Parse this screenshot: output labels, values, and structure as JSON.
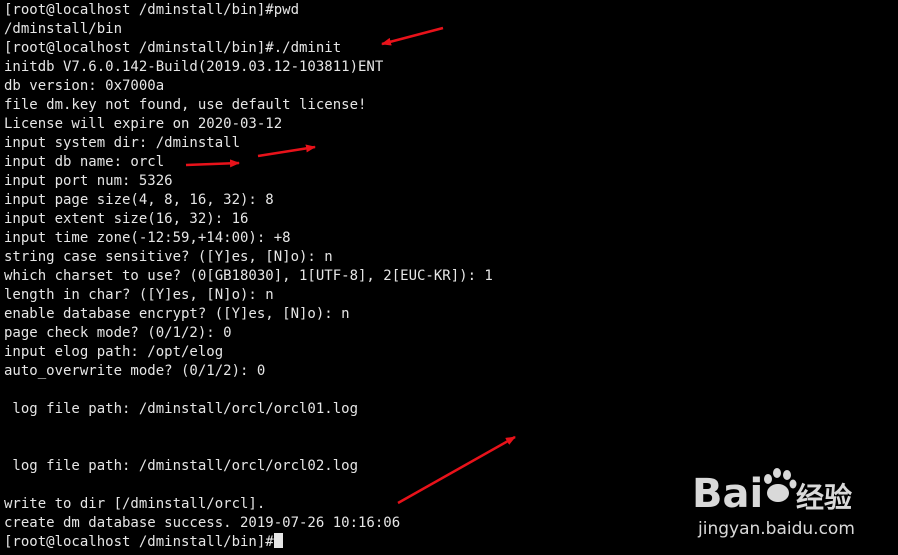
{
  "terminal": {
    "lines": [
      "[root@localhost /dminstall/bin]#pwd",
      "/dminstall/bin",
      "[root@localhost /dminstall/bin]#./dminit",
      "initdb V7.6.0.142-Build(2019.03.12-103811)ENT",
      "db version: 0x7000a",
      "file dm.key not found, use default license!",
      "License will expire on 2020-03-12",
      "input system dir: /dminstall",
      "input db name: orcl",
      "input port num: 5326",
      "input page size(4, 8, 16, 32): 8",
      "input extent size(16, 32): 16",
      "input time zone(-12:59,+14:00): +8",
      "string case sensitive? ([Y]es, [N]o): n",
      "which charset to use? (0[GB18030], 1[UTF-8], 2[EUC-KR]): 1",
      "length in char? ([Y]es, [N]o): n",
      "enable database encrypt? ([Y]es, [N]o): n",
      "page check mode? (0/1/2): 0",
      "input elog path: /opt/elog",
      "auto_overwrite mode? (0/1/2): 0",
      "",
      " log file path: /dminstall/orcl/orcl01.log",
      "",
      "",
      " log file path: /dminstall/orcl/orcl02.log",
      "",
      "write to dir [/dminstall/orcl].",
      "create dm database success. 2019-07-26 10:16:06",
      "[root@localhost /dminstall/bin]#"
    ],
    "text_color": "#e6e6e6",
    "background": "#000000",
    "cursor_color": "#e6e6e6"
  },
  "annotations": {
    "arrow_color": "#e8121a"
  },
  "watermark": {
    "logo_text": "Bai",
    "logo_suffix": "经验",
    "url": "jingyan.baidu.com"
  }
}
